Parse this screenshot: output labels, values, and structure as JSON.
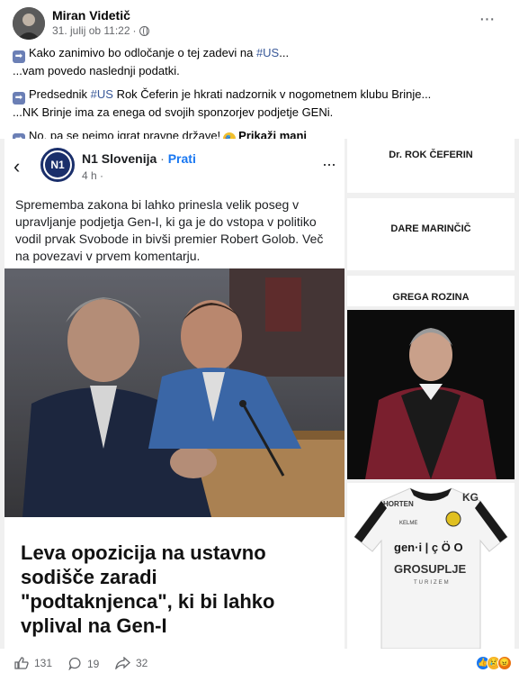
{
  "header": {
    "author": "Miran Videtič",
    "timestamp": "31. julij ob 11:22",
    "privacy_separator": "·",
    "more_label": "···"
  },
  "post": {
    "p1_line1_pre": "Kako zanimivo bo odločanje o tej zadevi na ",
    "p1_line1_tag": "#US",
    "p1_line1_post": "...",
    "p1_line2": "...vam povedo naslednji podatki.",
    "p2_line1_pre": "Predsednik ",
    "p2_line1_tag": "#US",
    "p2_line1_post": " Rok Čeferin je hkrati nadzornik v nogometnem klubu Brinje...",
    "p2_line2": "...NK Brinje ima za enega od svojih sponzorjev podjetje GENi.",
    "p3_text": "No, pa se pejmo igrat pravne države!",
    "show_less": "Prikaži manj",
    "arrow_emoji": "➡",
    "mask_emoji": "🎭"
  },
  "n1_card": {
    "page_name": "N1 Slovenija",
    "dot": "·",
    "follow_label": "Prati",
    "time": "4 h ·",
    "logo_text": "N1",
    "back_icon": "‹",
    "more_icon": "···",
    "text_lines": [
      "Sprememba zakona bi lahko prinesla velik poseg v",
      "upravljanje podjetja Gen-I, ki ga je do vstopa v politiko",
      "vodil prvak Svobode in bivši premier Robert Golob. Več",
      "na povezavi v prvem komentarju."
    ],
    "headline_lines": [
      "Leva opozicija na ustavno",
      "sodišče zaradi",
      "\"podtaknjenca\", ki bi lahko",
      "vplival na Gen-I"
    ]
  },
  "right_cards": {
    "name1": "Dr. ROK ČEFERIN",
    "name2": "DARE MARINČIČ",
    "name3": "GREGA ROZINA",
    "jersey": {
      "brand1": "HORTEN",
      "brand_logo": "KG",
      "kelme": "KELME",
      "geni": "gen·i | ç Ö O",
      "sponsor": "GROSUPLJE",
      "sub": "TURIZEM"
    }
  },
  "footer": {
    "like_count": "131",
    "comment_count": "19",
    "share_count": "32"
  },
  "colors": {
    "hashtag": "#385898",
    "follow": "#1877f2",
    "n1_navy": "#1a2f6b",
    "robe": "#7a1f2e"
  }
}
